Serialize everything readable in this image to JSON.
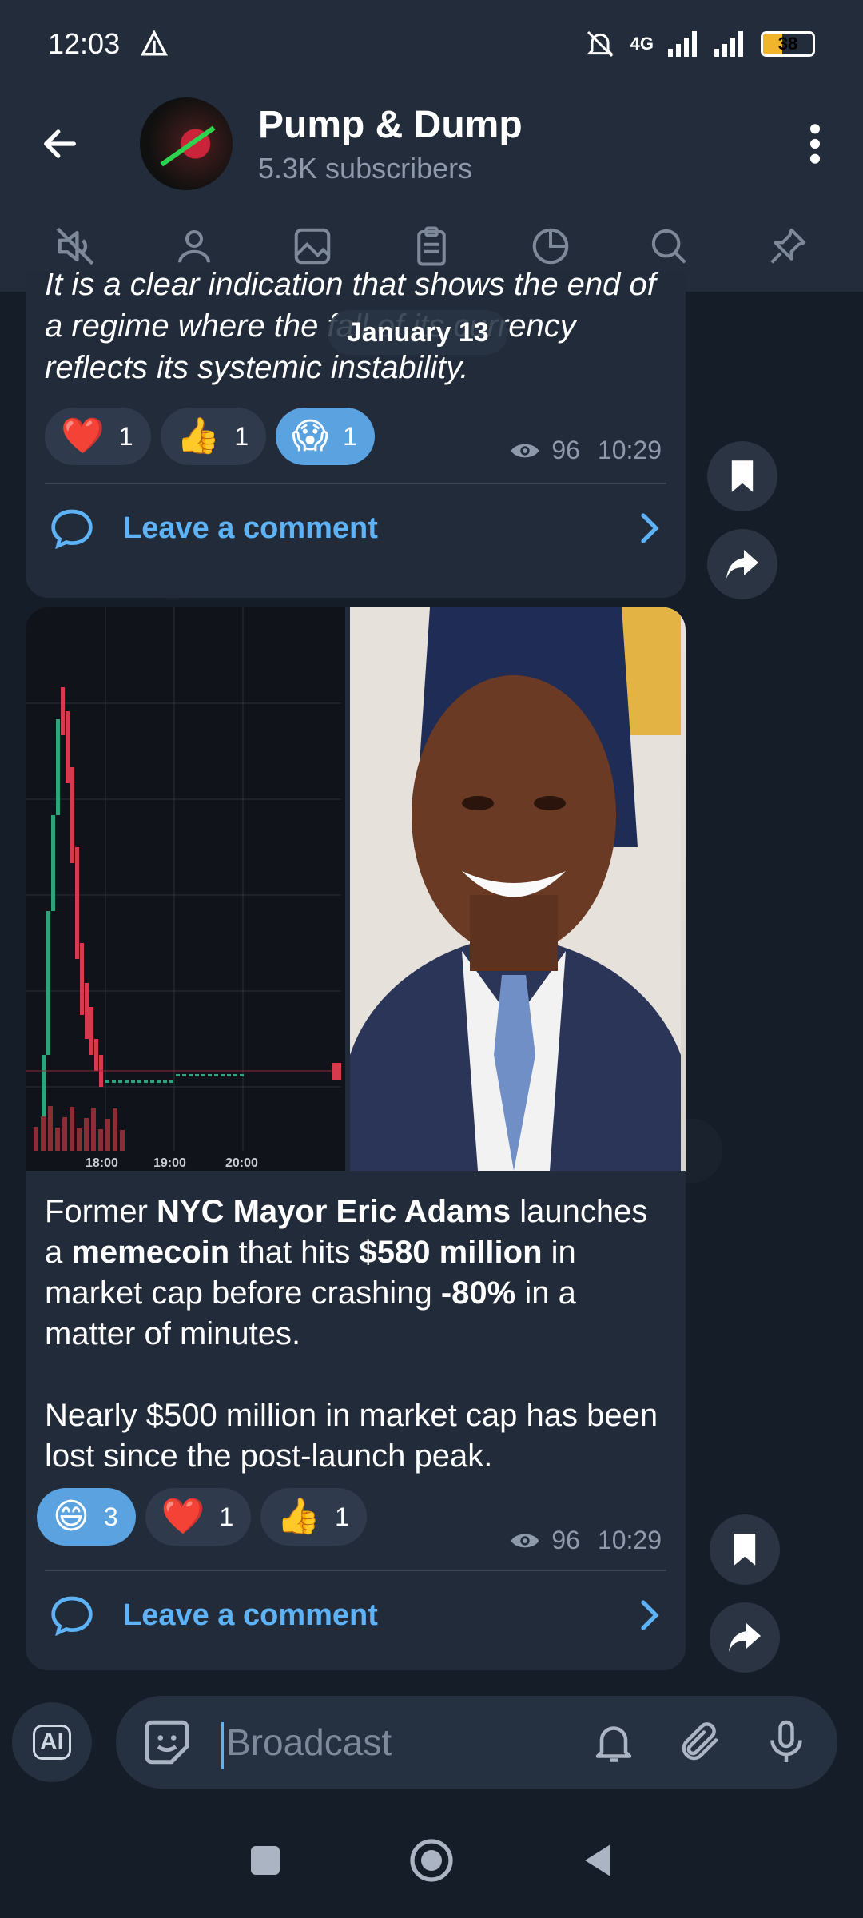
{
  "status_bar": {
    "time": "12:03",
    "network": "4G",
    "battery": "38",
    "battery_level": 0.38
  },
  "header": {
    "title": "Pump & Dump",
    "subtitle": "5.3K subscribers"
  },
  "toolbar": {
    "icons": [
      "mute-icon",
      "profile-icon",
      "media-icon",
      "files-icon",
      "stats-icon",
      "search-icon",
      "pin-icon"
    ]
  },
  "date_pill": "January 13",
  "message1": {
    "text": "It is a clear indication that shows the end of a regime where the fall of its currency reflects its systemic instability.",
    "reactions": [
      {
        "emoji": "❤️",
        "count": "1",
        "active": false
      },
      {
        "emoji": "👍",
        "count": "1",
        "active": false
      },
      {
        "emoji": "😱",
        "count": "1",
        "active": true
      }
    ],
    "views": "96",
    "time": "10:29",
    "comment_label": "Leave a comment"
  },
  "message2": {
    "chart_ticks": [
      "18:00",
      "19:00",
      "20:00"
    ],
    "text_parts": [
      {
        "t": "Former ",
        "b": false
      },
      {
        "t": "NYC Mayor Eric Adams",
        "b": true
      },
      {
        "t": " launches a ",
        "b": false
      },
      {
        "t": "memecoin",
        "b": true
      },
      {
        "t": " that hits ",
        "b": false
      },
      {
        "t": "$580 million",
        "b": true
      },
      {
        "t": " in market cap before crashing ",
        "b": false
      },
      {
        "t": "-80%",
        "b": true
      },
      {
        "t": " in a matter of minutes.",
        "b": false
      }
    ],
    "text_para2": "Nearly $500 million in market cap has been lost since the post-launch peak.",
    "reactions": [
      {
        "emoji": "😄",
        "count": "3",
        "active": true
      },
      {
        "emoji": "❤️",
        "count": "1",
        "active": false
      },
      {
        "emoji": "👍",
        "count": "1",
        "active": false
      }
    ],
    "views": "96",
    "time": "10:29",
    "comment_label": "Leave a comment"
  },
  "input": {
    "ai_label": "AI",
    "placeholder": "Broadcast"
  },
  "colors": {
    "accent": "#5db3f5",
    "bubble": "#222b39",
    "header": "#222c3a"
  }
}
